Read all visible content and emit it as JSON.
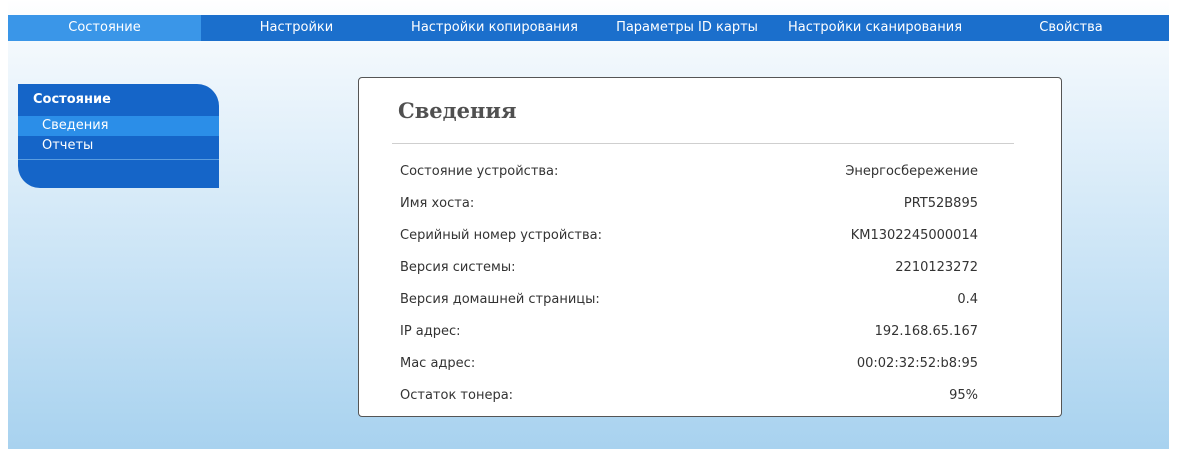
{
  "nav": {
    "items": [
      {
        "label": "Состояние"
      },
      {
        "label": "Настройки"
      },
      {
        "label": "Настройки копирования"
      },
      {
        "label": "Параметры ID карты"
      },
      {
        "label": "Настройки сканирования"
      },
      {
        "label": "Свойства"
      }
    ]
  },
  "sidebar": {
    "title": "Состояние",
    "items": [
      {
        "label": "Сведения"
      },
      {
        "label": "Отчеты"
      }
    ]
  },
  "panel": {
    "title": "Сведения",
    "rows": [
      {
        "label": "Состояние устройства:",
        "value": "Энергосбережение"
      },
      {
        "label": "Имя хоста:",
        "value": "PRT52B895"
      },
      {
        "label": "Серийный номер устройства:",
        "value": "KM1302245000014"
      },
      {
        "label": "Версия системы:",
        "value": "2210123272"
      },
      {
        "label": "Версия домашней страницы:",
        "value": "0.4"
      },
      {
        "label": "IP адрес:",
        "value": "192.168.65.167"
      },
      {
        "label": "Mac адрес:",
        "value": "00:02:32:52:b8:95"
      },
      {
        "label": "Остаток тонера:",
        "value": "95%"
      }
    ]
  },
  "colors": {
    "nav_bar": "#1b6fcc",
    "nav_active": "#3a96e8",
    "sidebar": "#1565c8",
    "sidebar_active": "#2b8ee8"
  }
}
